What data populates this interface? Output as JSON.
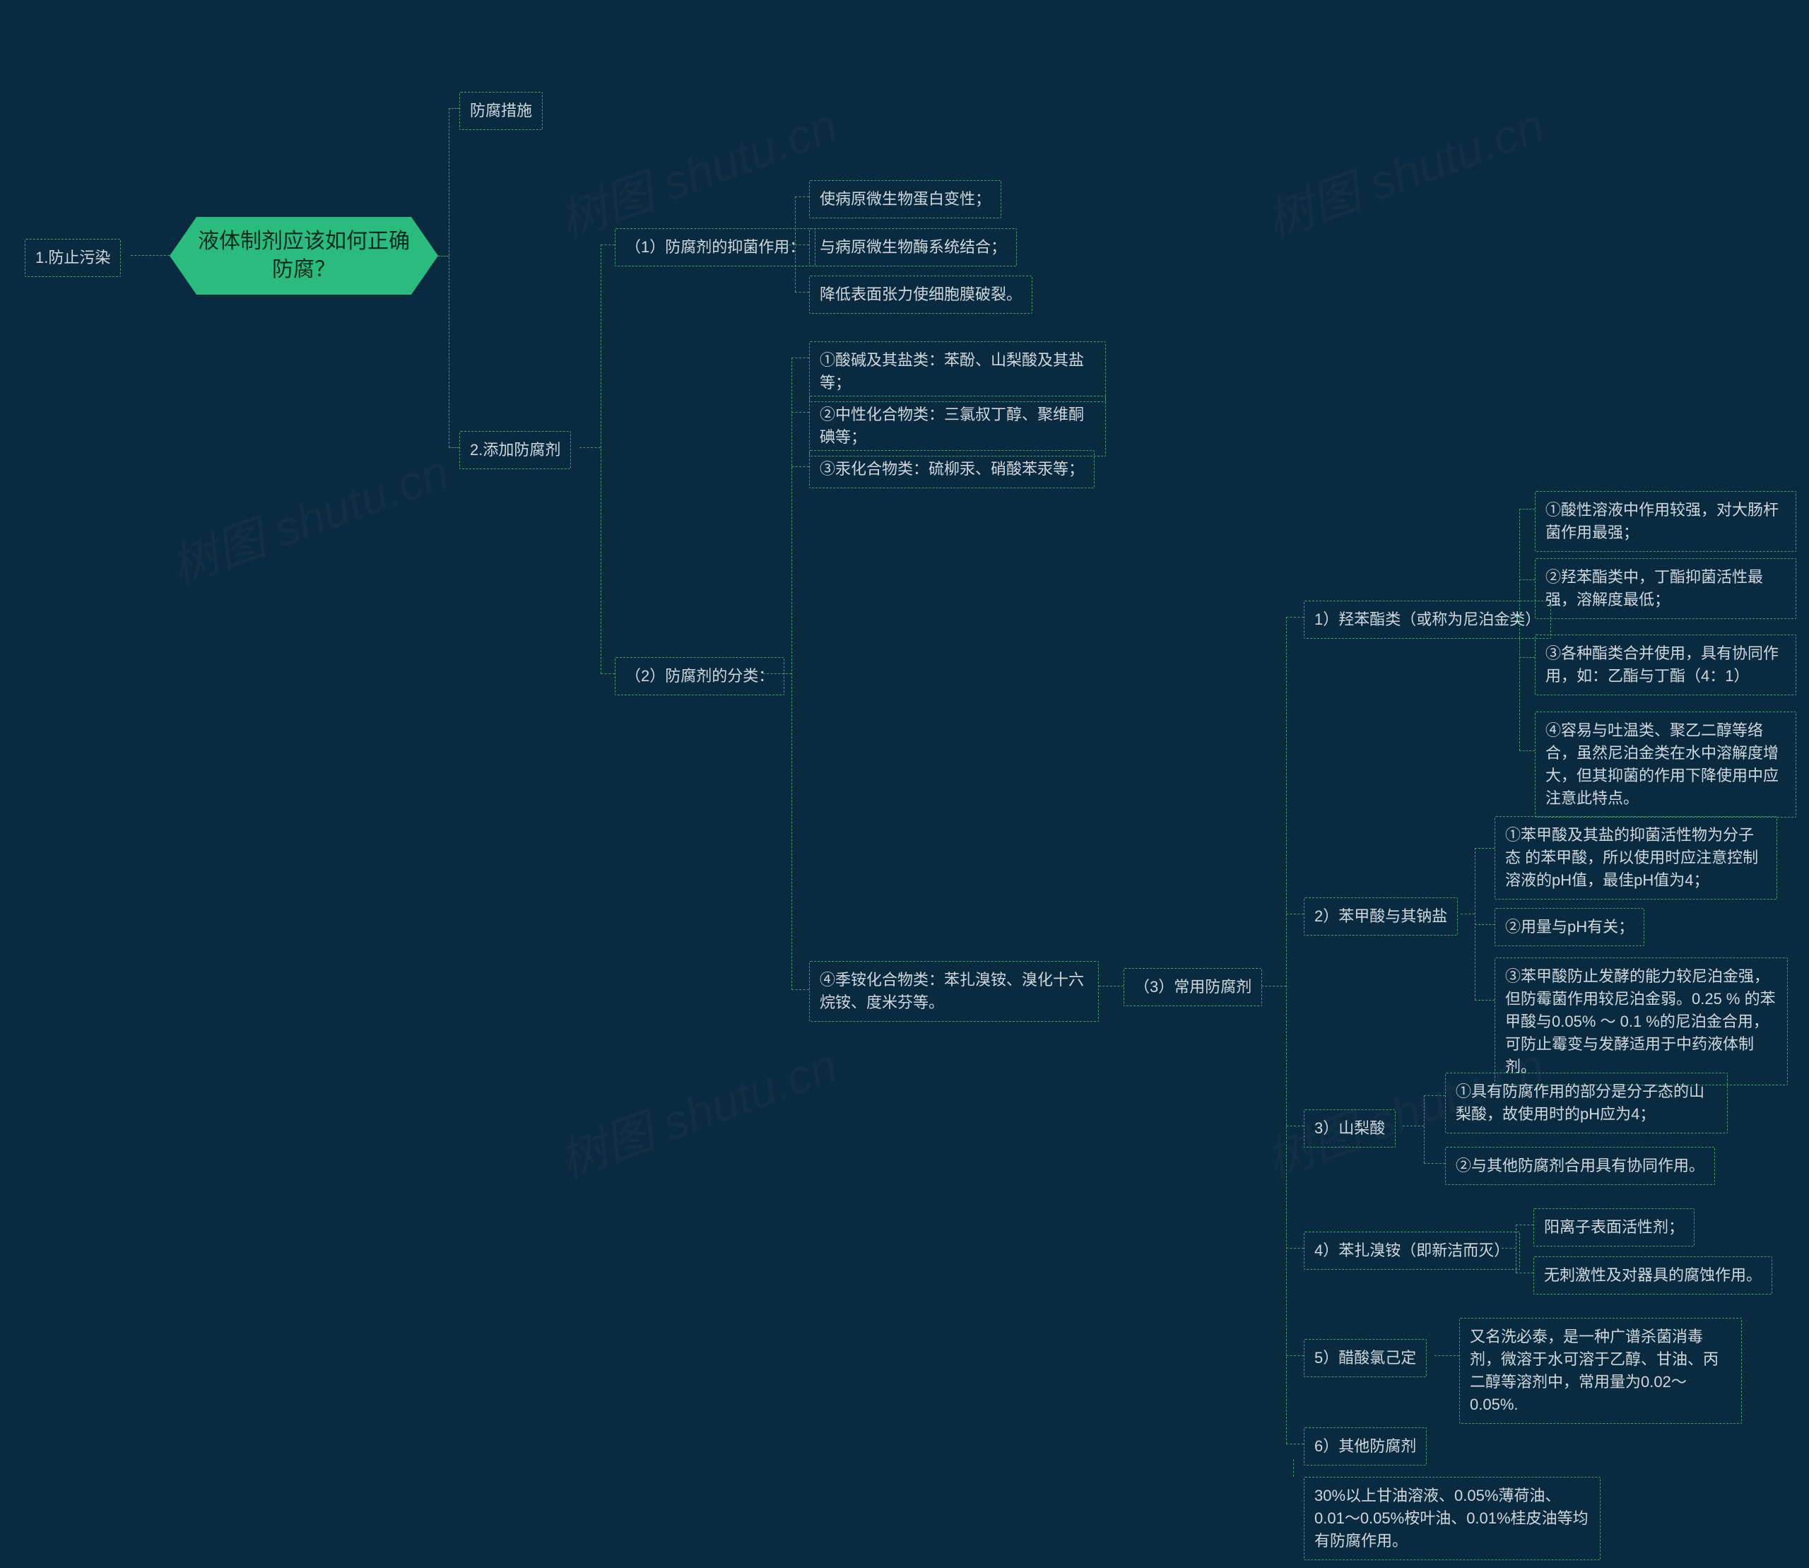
{
  "root": {
    "title": "液体制剂应该如何正确防腐？"
  },
  "level1": {
    "a": "1.防止污染",
    "b": "防腐措施",
    "c": "2.添加防腐剂"
  },
  "antisepticAction": {
    "label": "（1）防腐剂的抑菌作用：",
    "items": {
      "a": "使病原微生物蛋白变性；",
      "b": "与病原微生物酶系统结合；",
      "c": "降低表面张力使细胞膜破裂。"
    }
  },
  "classification": {
    "label": "（2）防腐剂的分类：",
    "items": {
      "a": "①酸碱及其盐类：苯酚、山梨酸及其盐等；",
      "b": "②中性化合物类：三氯叔丁醇、聚维酮碘等；",
      "c": "③汞化合物类：硫柳汞、硝酸苯汞等；",
      "d": "④季铵化合物类：苯扎溴铵、溴化十六烷铵、度米芬等。"
    }
  },
  "common": {
    "label": "（3）常用防腐剂",
    "paraben": {
      "label": "1）羟苯酯类（或称为尼泊金类）",
      "items": {
        "a": "①酸性溶液中作用较强，对大肠杆菌作用最强；",
        "b": "②羟苯酯类中，丁酯抑菌活性最强，溶解度最低；",
        "c": "③各种酯类合并使用，具有协同作用，如：乙酯与丁酯（4：1）",
        "d": "④容易与吐温类、聚乙二醇等络合，虽然尼泊金类在水中溶解度增大，但其抑菌的作用下降使用中应注意此特点。"
      }
    },
    "benzoic": {
      "label": "2）苯甲酸与其钠盐",
      "items": {
        "a": "①苯甲酸及其盐的抑菌活性物为分子态 的苯甲酸，所以使用时应注意控制溶液的pH值，最佳pH值为4；",
        "b": "②用量与pH有关；",
        "c": "③苯甲酸防止发酵的能力较尼泊金强，但防霉菌作用较尼泊金弱。0.25 % 的苯甲酸与0.05% ～ 0.1 %的尼泊金合用，可防止霉变与发酵适用于中药液体制剂。"
      }
    },
    "sorbic": {
      "label": "3）山梨酸",
      "items": {
        "a": "①具有防腐作用的部分是分子态的山梨酸，故使用时的pH应为4；",
        "b": "②与其他防腐剂合用具有协同作用。"
      }
    },
    "benzalkonium": {
      "label": "4）苯扎溴铵（即新洁而灭）",
      "items": {
        "a": "阳离子表面活性剂；",
        "b": "无刺激性及对器具的腐蚀作用。"
      }
    },
    "chlorhexidine": {
      "label": "5）醋酸氯己定",
      "items": {
        "a": "又名洗必泰，是一种广谱杀菌消毒剂，微溶于水可溶于乙醇、甘油、丙二醇等溶剂中，常用量为0.02～0.05%."
      }
    },
    "other": {
      "label": "6）其他防腐剂",
      "items": {
        "a": "30%以上甘油溶液、0.05%薄荷油、0.01～0.05%桉叶油、0.01%桂皮油等均有防腐作用。"
      }
    }
  },
  "watermark": "树图 shutu.cn"
}
